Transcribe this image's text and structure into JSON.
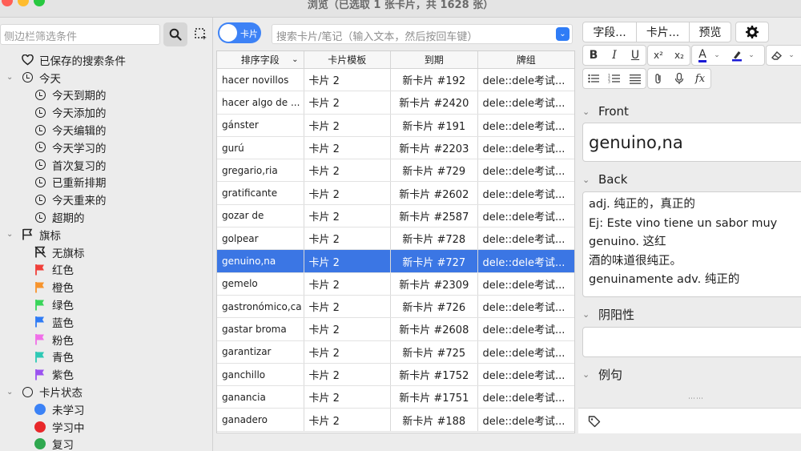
{
  "window": {
    "title": "浏览（已选取 1 张卡片，共 1628 张）"
  },
  "sidebar": {
    "search_placeholder": "侧边栏筛选条件",
    "items": [
      {
        "label": "已保存的搜索条件",
        "icon": "heart-icon",
        "level": 0
      },
      {
        "label": "今天",
        "icon": "clock-icon",
        "level": 0,
        "expanded": true
      },
      {
        "label": "今天到期的",
        "icon": "clock-icon",
        "level": 1
      },
      {
        "label": "今天添加的",
        "icon": "clock-icon",
        "level": 1
      },
      {
        "label": "今天编辑的",
        "icon": "clock-icon",
        "level": 1
      },
      {
        "label": "今天学习的",
        "icon": "clock-icon",
        "level": 1
      },
      {
        "label": "首次复习的",
        "icon": "clock-icon",
        "level": 1
      },
      {
        "label": "已重新排期",
        "icon": "clock-icon",
        "level": 1
      },
      {
        "label": "今天重来的",
        "icon": "clock-icon",
        "level": 1
      },
      {
        "label": "超期的",
        "icon": "clock-icon",
        "level": 1
      },
      {
        "label": "旗标",
        "icon": "flag-outline-icon",
        "level": 0,
        "expanded": true
      },
      {
        "label": "无旗标",
        "icon": "flag-off-icon",
        "level": 1
      },
      {
        "label": "红色",
        "icon": "flag-icon",
        "color": "#f0403a",
        "level": 1
      },
      {
        "label": "橙色",
        "icon": "flag-icon",
        "color": "#f7942d",
        "level": 1
      },
      {
        "label": "绿色",
        "icon": "flag-icon",
        "color": "#39d55a",
        "level": 1
      },
      {
        "label": "蓝色",
        "icon": "flag-icon",
        "color": "#2f7bf5",
        "level": 1
      },
      {
        "label": "粉色",
        "icon": "flag-icon",
        "color": "#f06fe8",
        "level": 1
      },
      {
        "label": "青色",
        "icon": "flag-icon",
        "color": "#2ec9b5",
        "level": 1
      },
      {
        "label": "紫色",
        "icon": "flag-icon",
        "color": "#9b52f0",
        "level": 1
      },
      {
        "label": "卡片状态",
        "icon": "circle-icon",
        "level": 0,
        "expanded": true
      },
      {
        "label": "未学习",
        "icon": "dot-icon",
        "color": "#3b82f6",
        "level": 1
      },
      {
        "label": "学习中",
        "icon": "dot-icon",
        "color": "#e8282a",
        "level": 1
      },
      {
        "label": "复习",
        "icon": "dot-icon",
        "color": "#2fa84f",
        "level": 1
      }
    ]
  },
  "toolbar": {
    "toggle_label": "卡片",
    "search_placeholder": "搜索卡片/笔记（输入文本，然后按回车键）"
  },
  "table": {
    "columns": [
      "排序字段",
      "卡片模板",
      "到期",
      "牌组"
    ],
    "rows": [
      [
        "hacer novillos",
        "卡片 2",
        "新卡片 #192",
        "dele::dele考试..."
      ],
      [
        "hacer algo de ...",
        "卡片 2",
        "新卡片 #2420",
        "dele::dele考试..."
      ],
      [
        "gánster",
        "卡片 2",
        "新卡片 #191",
        "dele::dele考试..."
      ],
      [
        "gurú",
        "卡片 2",
        "新卡片 #2203",
        "dele::dele考试..."
      ],
      [
        "gregario,ria",
        "卡片 2",
        "新卡片 #729",
        "dele::dele考试..."
      ],
      [
        "gratificante",
        "卡片 2",
        "新卡片 #2602",
        "dele::dele考试..."
      ],
      [
        "gozar de",
        "卡片 2",
        "新卡片 #2587",
        "dele::dele考试..."
      ],
      [
        "golpear",
        "卡片 2",
        "新卡片 #728",
        "dele::dele考试..."
      ],
      [
        "genuino,na",
        "卡片 2",
        "新卡片 #727",
        "dele::dele考试..."
      ],
      [
        "gemelo",
        "卡片 2",
        "新卡片 #2309",
        "dele::dele考试..."
      ],
      [
        "gastronómico,ca",
        "卡片 2",
        "新卡片 #726",
        "dele::dele考试..."
      ],
      [
        "gastar broma",
        "卡片 2",
        "新卡片 #2608",
        "dele::dele考试..."
      ],
      [
        "garantizar",
        "卡片 2",
        "新卡片 #725",
        "dele::dele考试..."
      ],
      [
        "ganchillo",
        "卡片 2",
        "新卡片 #1752",
        "dele::dele考试..."
      ],
      [
        "ganancia",
        "卡片 2",
        "新卡片 #1751",
        "dele::dele考试..."
      ],
      [
        "ganadero",
        "卡片 2",
        "新卡片 #188",
        "dele::dele考试..."
      ]
    ],
    "selected_row": 8
  },
  "editor": {
    "buttons": [
      "字段...",
      "卡片...",
      "预览"
    ],
    "fields": [
      {
        "name": "Front",
        "value": "genuino,na"
      },
      {
        "name": "Back",
        "lines": [
          "adj. 纯正的，真正的",
          "Ej: Este vino tiene un sabor muy",
          "genuino. 这红",
          "酒的味道很纯正。",
          "genuinamente adv. 纯正的"
        ]
      },
      {
        "name": "阴阳性",
        "value": ""
      },
      {
        "name": "例句",
        "value": ""
      }
    ]
  },
  "colors": {
    "accent": "#3b76e4",
    "toggle": "#3d82f6"
  }
}
